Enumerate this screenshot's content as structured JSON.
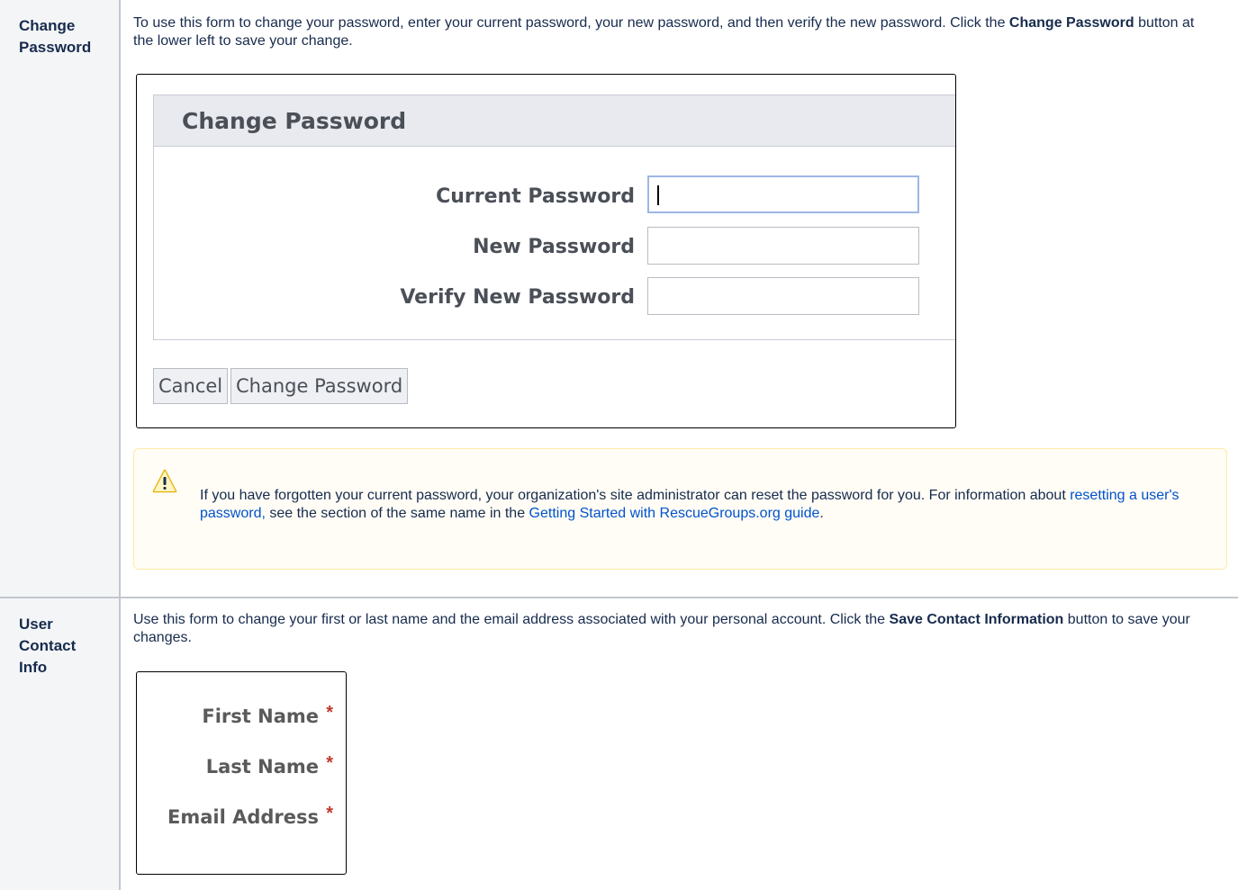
{
  "sections": [
    {
      "heading": "Change Password",
      "description": {
        "part1": "To use this form to change your password, enter your current password, your new password, and then verify the new password. Click the ",
        "bold": "Change Password",
        "part2": " button at the lower left to save your change."
      },
      "form": {
        "title": "Change Password",
        "fields": [
          {
            "label": "Current Password",
            "value": ""
          },
          {
            "label": "New Password",
            "value": ""
          },
          {
            "label": "Verify New Password",
            "value": ""
          }
        ],
        "buttons": {
          "cancel": "Cancel",
          "submit": "Change Password"
        }
      },
      "warning": {
        "icon": "warning-icon",
        "text1": "If you have forgotten your current password, your organization's site administrator can reset the password for you. For information about ",
        "link1": "resetting a user's password,",
        "text2": " see the section of the same name in the ",
        "link2": "Getting Started with RescueGroups.org guide",
        "text3": "."
      }
    },
    {
      "heading": "User Contact Info",
      "description": {
        "part1": "Use this form to change your first or last name and the email address associated with your personal account. Click the ",
        "bold": "Save Contact Information",
        "part2": " button to save your changes."
      },
      "form": {
        "fields": [
          {
            "label": "First Name",
            "required": "*"
          },
          {
            "label": "Last Name",
            "required": "*"
          },
          {
            "label": "Email Address",
            "required": "*"
          }
        ]
      }
    }
  ],
  "colors": {
    "header_bg": "#f4f5f7",
    "link": "#0052cc",
    "warning_bg": "#fffdf6",
    "warning_border": "#ffeaa6",
    "required": "#c0392b"
  }
}
